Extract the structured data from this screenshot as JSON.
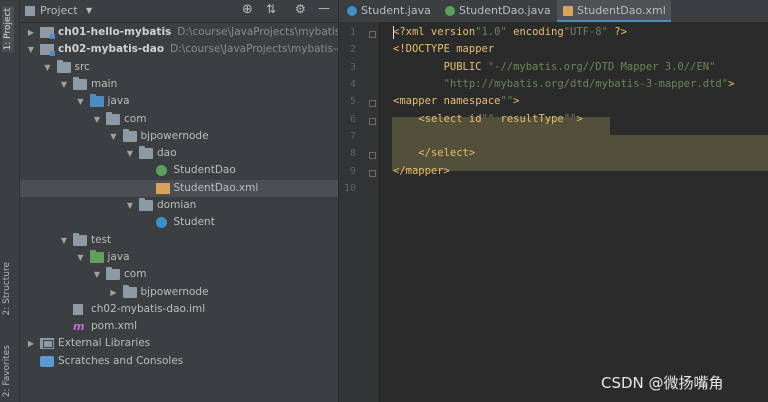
{
  "tool_strip": {
    "project": "1: Project",
    "structure": "2: Structure",
    "favorites": "2: Favorites"
  },
  "panel_header": {
    "title": "Project",
    "dropdown_icon": "chevron-down-icon",
    "icons": [
      "locate-icon",
      "collapse-icon",
      "gear-icon",
      "minimize-icon"
    ]
  },
  "tree": [
    {
      "label": "ch01-hello-mybatis",
      "path": "D:\\course\\JavaProjects\\mybatis-cour",
      "icon": "module",
      "indent": 0,
      "arrow": "collapsed",
      "bold": true
    },
    {
      "label": "ch02-mybatis-dao",
      "path": "D:\\course\\JavaProjects\\mybatis-cours",
      "icon": "module",
      "indent": 0,
      "arrow": "expanded",
      "bold": true
    },
    {
      "label": "src",
      "icon": "folder",
      "indent": 1,
      "arrow": "expanded"
    },
    {
      "label": "main",
      "icon": "folder",
      "indent": 2,
      "arrow": "expanded"
    },
    {
      "label": "java",
      "icon": "folder-blue",
      "indent": 3,
      "arrow": "expanded"
    },
    {
      "label": "com",
      "icon": "package",
      "indent": 4,
      "arrow": "expanded"
    },
    {
      "label": "bjpowernode",
      "icon": "package",
      "indent": 5,
      "arrow": "expanded"
    },
    {
      "label": "dao",
      "icon": "package",
      "indent": 6,
      "arrow": "expanded"
    },
    {
      "label": "StudentDao",
      "icon": "interface",
      "indent": 7,
      "arrow": "none"
    },
    {
      "label": "StudentDao.xml",
      "icon": "xml",
      "indent": 7,
      "arrow": "none",
      "selected": true
    },
    {
      "label": "domian",
      "icon": "package",
      "indent": 6,
      "arrow": "expanded"
    },
    {
      "label": "Student",
      "icon": "class",
      "indent": 7,
      "arrow": "none"
    },
    {
      "label": "test",
      "icon": "folder",
      "indent": 2,
      "arrow": "expanded"
    },
    {
      "label": "java",
      "icon": "folder-green",
      "indent": 3,
      "arrow": "expanded"
    },
    {
      "label": "com",
      "icon": "package",
      "indent": 4,
      "arrow": "expanded"
    },
    {
      "label": "bjpowernode",
      "icon": "package",
      "indent": 5,
      "arrow": "collapsed"
    },
    {
      "label": "ch02-mybatis-dao.iml",
      "icon": "iml",
      "indent": 2,
      "arrow": "none"
    },
    {
      "label": "pom.xml",
      "icon": "maven",
      "indent": 2,
      "arrow": "none"
    },
    {
      "label": "External Libraries",
      "icon": "library",
      "indent": 0,
      "arrow": "collapsed"
    },
    {
      "label": "Scratches and Consoles",
      "icon": "scratch",
      "indent": 0,
      "arrow": "none"
    }
  ],
  "tabs": [
    {
      "label": "Student.java",
      "icon": "class",
      "active": false
    },
    {
      "label": "StudentDao.java",
      "icon": "interface",
      "active": false
    },
    {
      "label": "StudentDao.xml",
      "icon": "xml",
      "active": true
    }
  ],
  "editor": {
    "line_numbers": [
      "1",
      "2",
      "3",
      "4",
      "5",
      "6",
      "7",
      "8",
      "9",
      "10"
    ],
    "lines": [
      "<?xml version=\"1.0\" encoding=\"UTF-8\" ?>",
      "<!DOCTYPE mapper",
      "        PUBLIC \"-//mybatis.org//DTD Mapper 3.0//EN\"",
      "        \"http://mybatis.org/dtd/mybatis-3-mapper.dtd\">",
      "<mapper namespace=\"\">",
      "    <select id=\"\" resultType=\"\">",
      "",
      "    </select>",
      "</mapper>",
      ""
    ]
  },
  "watermark": "CSDN @微扬嘴角",
  "colors": {
    "tag": "#e8bf6a",
    "attr": "#bababa",
    "string": "#6a8759",
    "highlight": "#52503a",
    "selection": "#4b4e52"
  }
}
